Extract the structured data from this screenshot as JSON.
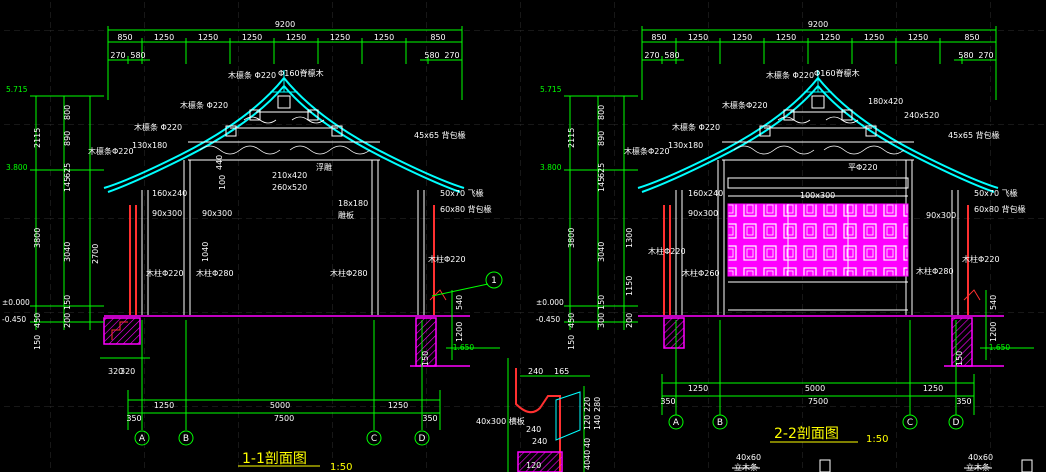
{
  "colors": {
    "background": "#000000",
    "grid": "#3a3a3a",
    "dimension": "#00ff00",
    "roof": "#00ffff",
    "structure": "#ff00ff",
    "wood_red": "#ff3030",
    "text": "#ffffff",
    "title": "#ffff00",
    "panel": "#ff00ff"
  },
  "section_1": {
    "title": "1-1剖面图",
    "scale": "1:50",
    "overall_width": "9200",
    "top_dims": [
      "850",
      "1250",
      "1250",
      "1250",
      "1250",
      "1250",
      "1250",
      "850"
    ],
    "second_dims": [
      "270",
      "580",
      "580",
      "270"
    ],
    "bottom_dims": [
      "1250",
      "5000",
      "1250"
    ],
    "bottom_total": "7500",
    "edge_dims": [
      "350",
      "350"
    ],
    "plinth_dims": [
      "320",
      "320"
    ],
    "axes": [
      "A",
      "B",
      "C",
      "D"
    ],
    "callout": "1",
    "elevations": [
      "5.715",
      "3.800",
      "±0.000",
      "-0.450",
      "-1.650"
    ],
    "left_dims": [
      "800",
      "890",
      "2115",
      "625",
      "145",
      "3800",
      "2700",
      "3040",
      "150",
      "450",
      "150",
      "200"
    ],
    "right_dims": [
      "540",
      "1200",
      "150"
    ],
    "labels": {
      "ridge_purlin": "木檩条 Φ220",
      "ridge_tube": "Φ160脊檩木",
      "purlin_2": "木檩条 Φ220",
      "purlin_3": "木檩条 Φ220",
      "purlin_4": "木檩条Φ220",
      "beam_130": "130x180",
      "beam_160": "160x240",
      "beam_90a": "90x300",
      "beam_90b": "90x300",
      "beam_210": "210x420",
      "beam_260": "260x520",
      "floating_carving": "浮雕",
      "beam_18": "18x180",
      "carved": "雕板",
      "small_45": "45x65 背包椽",
      "small_50": "50x70 飞椽",
      "small_60": "60x80 背包椽",
      "col_220": "木柱Φ220",
      "col_280a": "木柱Φ280",
      "col_280b": "木柱Φ280",
      "col_220b": "木柱Φ220",
      "dim_440": "440",
      "dim_100": "100",
      "dim_1040": "1040"
    }
  },
  "section_2": {
    "title": "2-2剖面图",
    "scale": "1:50",
    "overall_width": "9200",
    "top_dims": [
      "850",
      "1250",
      "1250",
      "1250",
      "1250",
      "1250",
      "1250",
      "850"
    ],
    "second_dims": [
      "270",
      "580",
      "580",
      "270"
    ],
    "bottom_dims": [
      "1250",
      "5000",
      "1250"
    ],
    "bottom_total": "7500",
    "edge_dims": [
      "350",
      "350"
    ],
    "axes": [
      "A",
      "B",
      "C",
      "D"
    ],
    "elevations": [
      "5.715",
      "3.800",
      "±0.000",
      "-0.450",
      "-1.650"
    ],
    "left_dims": [
      "800",
      "890",
      "2115",
      "625",
      "145",
      "3800",
      "1300",
      "3040",
      "1150",
      "150",
      "300",
      "450",
      "150",
      "200"
    ],
    "right_dims": [
      "540",
      "1200",
      "150"
    ],
    "labels": {
      "ridge_purlin": "木檩条 Φ220",
      "ridge_tube": "Φ160脊檩木",
      "purlin_2": "木檩条Φ220",
      "purlin_3": "木檩条 Φ220",
      "purlin_4": "木檩条Φ220",
      "beam_180": "180x420",
      "beam_240": "240x520",
      "beam_130": "130x180",
      "beam_160": "160x240",
      "beam_90a": "90x300",
      "beam_90b": "90x300",
      "beam_100": "100x300",
      "beam_ping": "平Φ220",
      "small_45": "45x65 背包椽",
      "small_50": "50x70 飞椽",
      "small_60": "60x80 背包椽",
      "col_220": "木柱Φ220",
      "col_260": "木柱Φ260",
      "col_280": "木柱Φ280",
      "col_220b": "木柱Φ220"
    }
  },
  "detail": {
    "dims_top": [
      "240",
      "165"
    ],
    "dims_v": [
      "220",
      "120",
      "280",
      "140",
      "40",
      "40",
      "40"
    ],
    "labels": [
      "40x300 横板",
      "240",
      "240",
      "120"
    ],
    "bottom_notes": [
      "40x60",
      "立木条",
      "40x60",
      "立木条"
    ]
  }
}
